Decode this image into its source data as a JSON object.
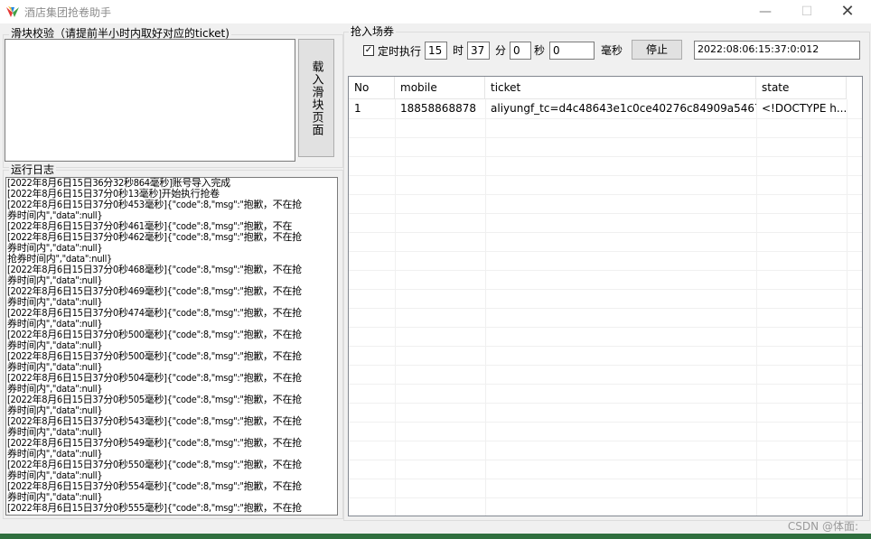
{
  "window": {
    "title": "酒店集团抢卷助手",
    "minimize_glyph": "—",
    "maximize_glyph": "☐",
    "close_glyph": "✕"
  },
  "slider_panel": {
    "title": "滑块校验（请提前半小时内取好对应的ticket)",
    "load_button": "载入滑块页面"
  },
  "log_panel": {
    "title": "运行日志",
    "lines": [
      "[2022年8月6日15日36分32秒864毫秒]账号导入完成",
      "[2022年8月6日15日37分0秒13毫秒]开始执行抢卷",
      "[2022年8月6日15日37分0秒453毫秒]{\"code\":8,\"msg\":\"抱歉，不在抢",
      "券时间内\",\"data\":null}",
      "[2022年8月6日15日37分0秒461毫秒]{\"code\":8,\"msg\":\"抱歉，不在",
      "[2022年8月6日15日37分0秒462毫秒]{\"code\":8,\"msg\":\"抱歉，不在抢",
      "券时间内\",\"data\":null}",
      "抢券时间内\",\"data\":null}",
      "[2022年8月6日15日37分0秒468毫秒]{\"code\":8,\"msg\":\"抱歉，不在抢",
      "券时间内\",\"data\":null}",
      "[2022年8月6日15日37分0秒469毫秒]{\"code\":8,\"msg\":\"抱歉，不在抢",
      "券时间内\",\"data\":null}",
      "[2022年8月6日15日37分0秒474毫秒]{\"code\":8,\"msg\":\"抱歉，不在抢",
      "券时间内\",\"data\":null}",
      "[2022年8月6日15日37分0秒500毫秒]{\"code\":8,\"msg\":\"抱歉，不在抢",
      "券时间内\",\"data\":null}",
      "[2022年8月6日15日37分0秒500毫秒]{\"code\":8,\"msg\":\"抱歉，不在抢",
      "券时间内\",\"data\":null}",
      "[2022年8月6日15日37分0秒504毫秒]{\"code\":8,\"msg\":\"抱歉，不在抢",
      "券时间内\",\"data\":null}",
      "[2022年8月6日15日37分0秒505毫秒]{\"code\":8,\"msg\":\"抱歉，不在抢",
      "券时间内\",\"data\":null}",
      "[2022年8月6日15日37分0秒543毫秒]{\"code\":8,\"msg\":\"抱歉，不在抢",
      "券时间内\",\"data\":null}",
      "[2022年8月6日15日37分0秒549毫秒]{\"code\":8,\"msg\":\"抱歉，不在抢",
      "券时间内\",\"data\":null}",
      "[2022年8月6日15日37分0秒550毫秒]{\"code\":8,\"msg\":\"抱歉，不在抢",
      "券时间内\",\"data\":null}",
      "[2022年8月6日15日37分0秒554毫秒]{\"code\":8,\"msg\":\"抱歉，不在抢",
      "券时间内\",\"data\":null}",
      "[2022年8月6日15日37分0秒555毫秒]{\"code\":8,\"msg\":\"抱歉，不在抢"
    ]
  },
  "grab_panel": {
    "title": "抢入场券",
    "scheduled_label": "定时执行",
    "scheduled_checked": true,
    "check_glyph": "✓",
    "hour_value": "15",
    "hour_unit": "时",
    "minute_value": "37",
    "minute_unit": "分",
    "second_value": "0",
    "second_unit": "秒",
    "ms_value": "0",
    "ms_unit": "毫秒",
    "stop_button": "停止",
    "clock": "2022:08:06:15:37:0:012"
  },
  "table": {
    "columns": [
      "No",
      "mobile",
      "ticket",
      "state"
    ],
    "rows": [
      [
        "1",
        "18858868878",
        "aliyungf_tc=d4c48643e1c0ce40276c84909a5467...",
        "<!DOCTYPE h..."
      ]
    ]
  },
  "watermark": "CSDN @体面:",
  "colors": {
    "window_bg": "#f0f0f0",
    "title_text": "#8c8c8c",
    "bottom_strip": "#2f6f3e"
  }
}
